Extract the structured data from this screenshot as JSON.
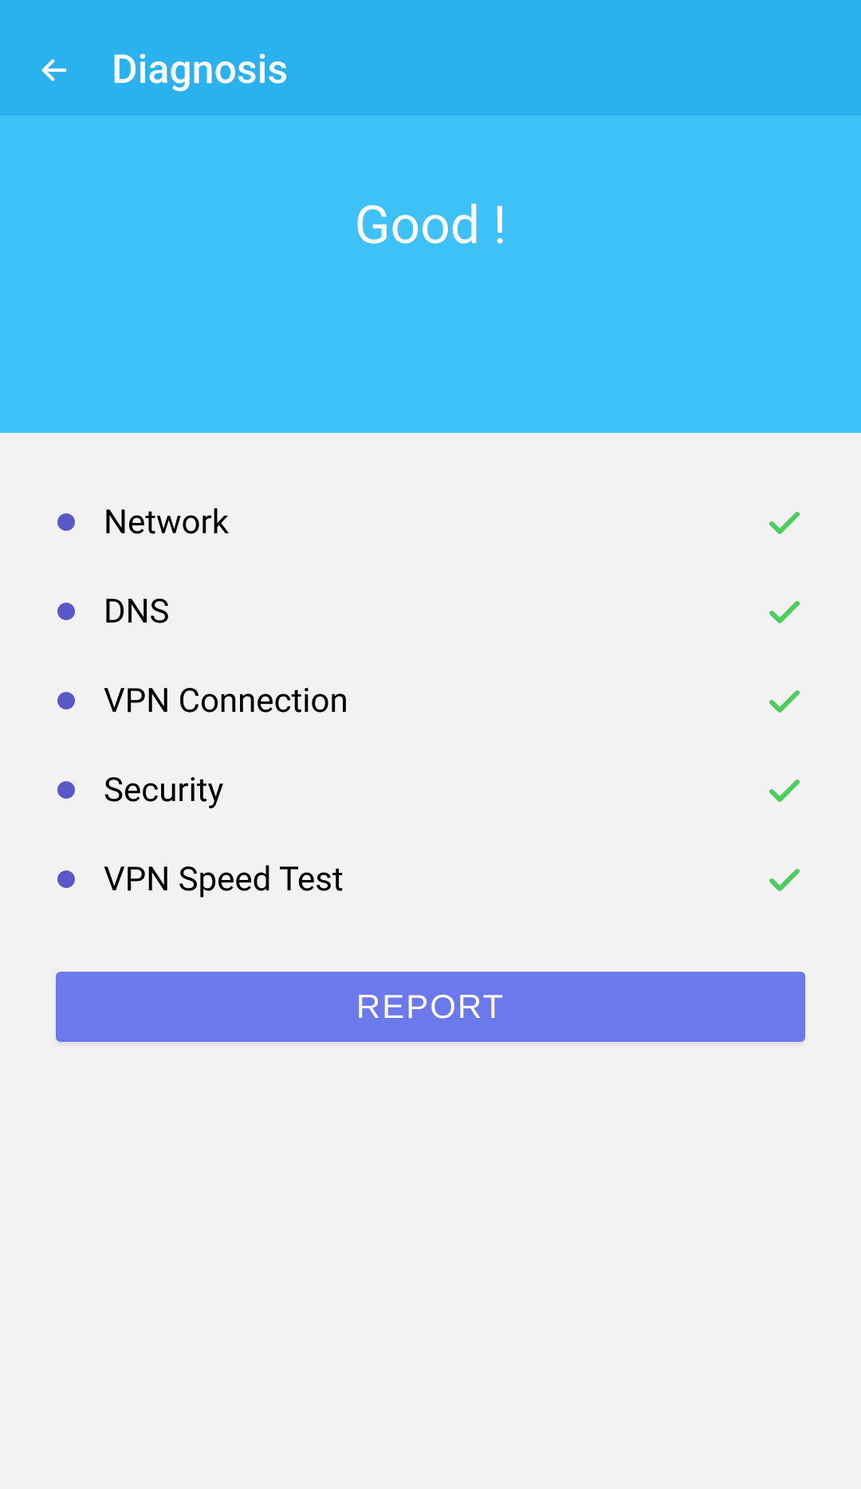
{
  "appBar": {
    "title": "Diagnosis"
  },
  "statusPanel": {
    "text": "Good !"
  },
  "checks": [
    {
      "label": "Network",
      "passed": true
    },
    {
      "label": "DNS",
      "passed": true
    },
    {
      "label": "VPN Connection",
      "passed": true
    },
    {
      "label": "Security",
      "passed": true
    },
    {
      "label": "VPN Speed Test",
      "passed": true
    }
  ],
  "buttons": {
    "report": "REPORT"
  }
}
